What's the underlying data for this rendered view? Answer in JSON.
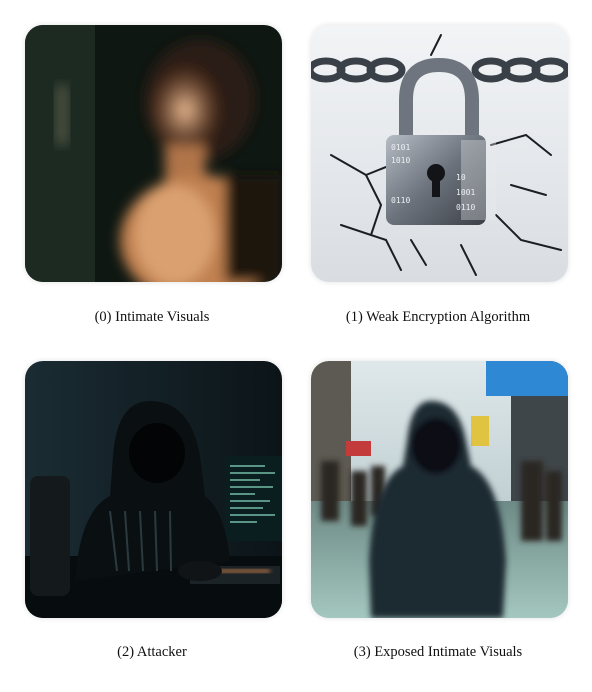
{
  "panels": [
    {
      "index": "(0)",
      "caption": "(0) Intimate Visuals",
      "image": "blurred-woman-portrait-photo"
    },
    {
      "index": "(1)",
      "caption": "(1) Weak Encryption Algorithm",
      "image": "cracked-padlock-binary-photo"
    },
    {
      "index": "(2)",
      "caption": "(2) Attacker",
      "image": "hooded-hacker-keyboard-photo"
    },
    {
      "index": "(3)",
      "caption": "(3) Exposed Intimate Visuals",
      "image": "hooded-figure-crowd-street-photo"
    }
  ]
}
